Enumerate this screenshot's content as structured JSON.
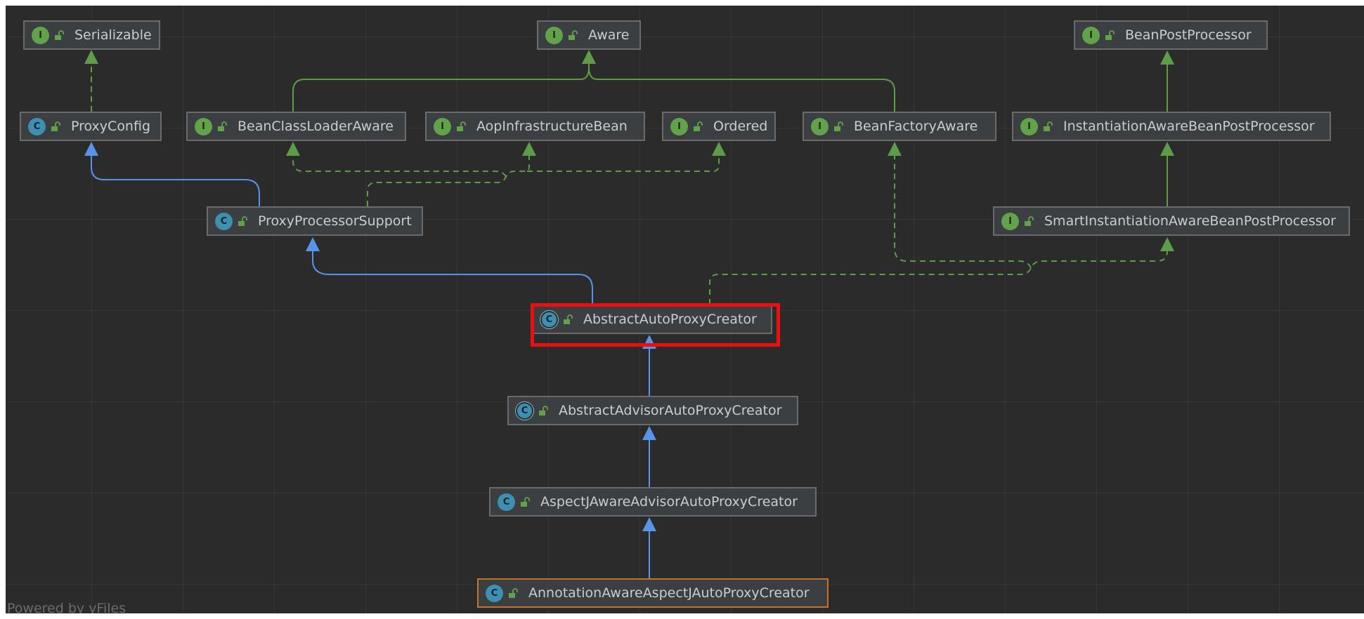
{
  "nodes": {
    "serializable": {
      "label": "Serializable",
      "kind": "I"
    },
    "aware": {
      "label": "Aware",
      "kind": "I"
    },
    "beanpostprocessor": {
      "label": "BeanPostProcessor",
      "kind": "I"
    },
    "proxyconfig": {
      "label": "ProxyConfig",
      "kind": "C"
    },
    "beanclassloaderaware": {
      "label": "BeanClassLoaderAware",
      "kind": "I"
    },
    "aopinfrastructurebean": {
      "label": "AopInfrastructureBean",
      "kind": "I"
    },
    "ordered": {
      "label": "Ordered",
      "kind": "I"
    },
    "beanfactoryaware": {
      "label": "BeanFactoryAware",
      "kind": "I"
    },
    "instantiationawarebeanpostprocessor": {
      "label": "InstantiationAwareBeanPostProcessor",
      "kind": "I"
    },
    "proxyprocessorsupport": {
      "label": "ProxyProcessorSupport",
      "kind": "C"
    },
    "smartinstantiationawarebeanpostprocessor": {
      "label": "SmartInstantiationAwareBeanPostProcessor",
      "kind": "I"
    },
    "abstractautoproxycreator": {
      "label": "AbstractAutoProxyCreator",
      "kind": "C"
    },
    "abstractadvisorautoproxycreator": {
      "label": "AbstractAdvisorAutoProxyCreator",
      "kind": "C"
    },
    "aspectjawareadvisorautoproxycreator": {
      "label": "AspectJAwareAdvisorAutoProxyCreator",
      "kind": "C"
    },
    "annotationawareaspectjautoproxycreator": {
      "label": "AnnotationAwareAspectJAutoProxyCreator",
      "kind": "C"
    }
  },
  "footer": "Powered by yFiles",
  "colors": {
    "background": "#2b2b2b",
    "node_fill": "#3c3f41",
    "extends_edge": "#5994e8",
    "implements_edge": "#5e9c48",
    "interface_badge": "#62a24a",
    "class_badge": "#3f8fb0",
    "highlight": "#ec0f0f",
    "bottom_border": "#c7722c"
  }
}
